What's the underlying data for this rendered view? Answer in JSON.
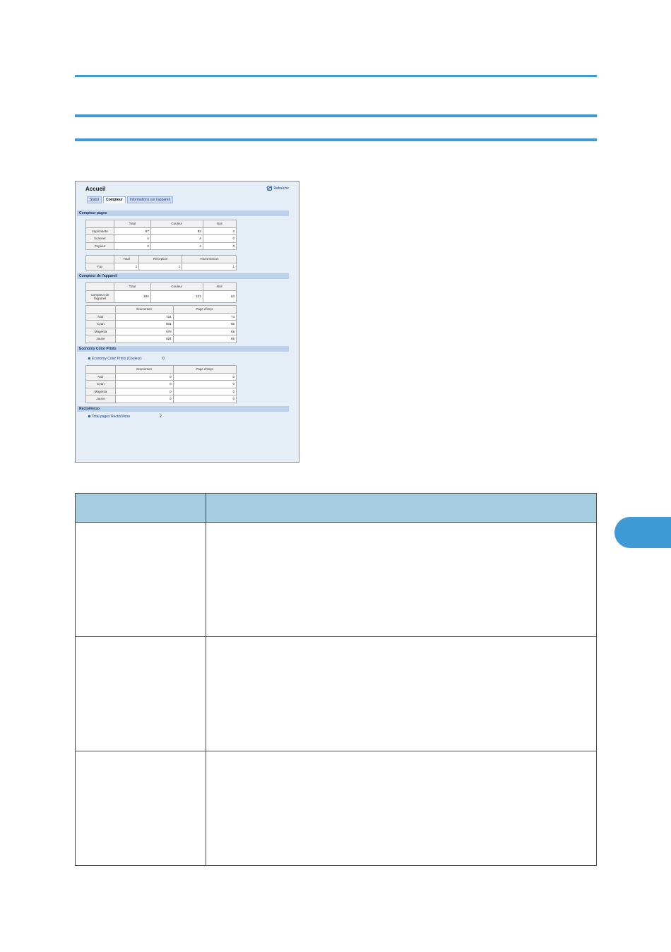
{
  "shot": {
    "title": "Accueil",
    "refresh_label": "Rafraîchir",
    "tabs": [
      "Statut",
      "Compteur",
      "Informations sur l'appareil"
    ],
    "sections": {
      "pages": "Compteur pages",
      "device": "Compteur de l'appareil",
      "economy": "Economy Color Prints",
      "duplex": "Recto/Verso"
    },
    "pages_table": {
      "headers": [
        "",
        "Total",
        "Couleur",
        "Noir"
      ],
      "rows": [
        [
          "Imprimante",
          "87",
          "83",
          "4"
        ],
        [
          "Scanner",
          "4",
          "4",
          "0"
        ],
        [
          "Copieur",
          "4",
          "4",
          "0"
        ]
      ]
    },
    "fax_table": {
      "headers": [
        "",
        "Total",
        "Réception",
        "Transmission"
      ],
      "rows": [
        [
          "Fax",
          "2",
          "1",
          "1"
        ]
      ]
    },
    "device_table": {
      "headers": [
        "",
        "Total",
        "Couleur",
        "Noir"
      ],
      "rows": [
        [
          "Compteur de l'appareil",
          "184",
          "121",
          "63"
        ]
      ]
    },
    "toner_table": {
      "headers": [
        "",
        "Couverture",
        "Page d'impr."
      ],
      "rows": [
        [
          "Noir",
          "724",
          "74"
        ],
        [
          "Cyan",
          "801",
          "65"
        ],
        [
          "Magenta",
          "878",
          "65"
        ],
        [
          "Jaune",
          "824",
          "65"
        ]
      ]
    },
    "economy_line": {
      "label": "Economy Color Prints (Couleur)",
      "value": "0"
    },
    "economy_table": {
      "headers": [
        "",
        "Couverture",
        "Page d'impr."
      ],
      "rows": [
        [
          "Noir",
          "0",
          "0"
        ],
        [
          "Cyan",
          "0",
          "0"
        ],
        [
          "Magenta",
          "0",
          "0"
        ],
        [
          "Jaune",
          "0",
          "0"
        ]
      ]
    },
    "duplex_line": {
      "label": "Total pages Recto/Verso",
      "value": "2"
    }
  },
  "colors": {
    "accent": "#3f9ad6",
    "table_header": "#a6cde0",
    "screen_bg": "#e5edf7",
    "section_bar": "#bcd1ea"
  }
}
